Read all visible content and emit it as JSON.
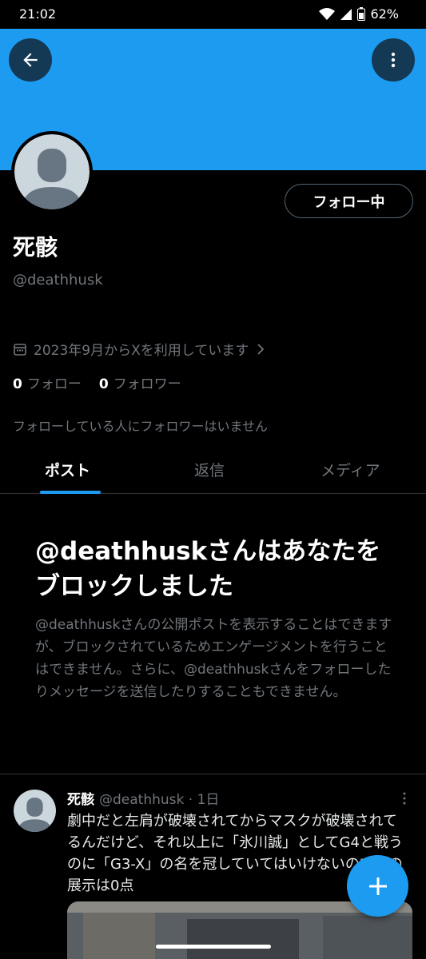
{
  "status_bar": {
    "time": "21:02",
    "battery": "62%"
  },
  "profile": {
    "display_name": "死骸",
    "handle": "@deathhusk",
    "follow_button": "フォロー中",
    "joined": "2023年9月からXを利用しています",
    "following_count": "0",
    "following_label": "フォロー",
    "followers_count": "0",
    "followers_label": "フォロワー",
    "mutuals_note": "フォローしている人にフォロワーはいません"
  },
  "tabs": [
    {
      "label": "ポスト",
      "active": true
    },
    {
      "label": "返信",
      "active": false
    },
    {
      "label": "メディア",
      "active": false
    }
  ],
  "blocked": {
    "title": "@deathhuskさんはあなたをブロックしました",
    "body": "@deathhuskさんの公開ポストを表示することはできますが、ブロックされているためエンゲージメントを行うことはできません。さらに、@deathhuskさんをフォローしたりメッセージを送信したりすることもできません。"
  },
  "tweet": {
    "name": "死骸",
    "handle": "@deathhusk",
    "time": "· 1日",
    "text": "劇中だと左肩が破壊されてからマスクが破壊されてるんだけど、それ以上に「氷川誠」としてG4と戦うのに「G3-X」の名を冠していてはいけないのでこの展示は0点"
  },
  "icons": {
    "back": "arrow-left-icon",
    "more": "more-vertical-icon",
    "calendar": "calendar-icon",
    "chevron": "chevron-right-icon",
    "compose": "plus-icon"
  },
  "colors": {
    "accent": "#1d9bf0",
    "background": "#000000",
    "muted": "#71767b"
  }
}
